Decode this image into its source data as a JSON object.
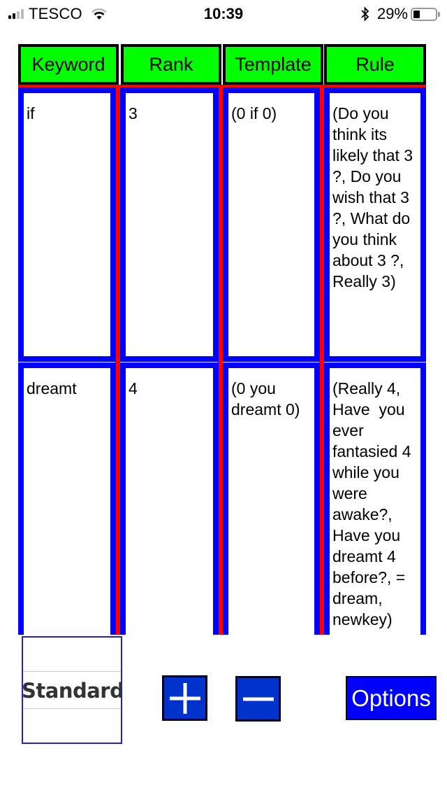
{
  "status_bar": {
    "carrier": "TESCO",
    "time": "10:39",
    "battery_percent_label": "29%",
    "battery_level": 0.29,
    "signal_bars_active": 2,
    "signal_bars_total": 4,
    "icons": [
      "signal-icon",
      "wifi-icon",
      "bluetooth-icon",
      "battery-icon"
    ]
  },
  "table": {
    "headers": [
      "Keyword",
      "Rank",
      "Template",
      "Rule"
    ],
    "rows": [
      {
        "keyword": "if",
        "rank": "3",
        "template": "(0 if 0)",
        "rule": "(Do you think its likely that 3 ?, Do you wish that 3 ?, What do you think about 3 ?, Really 3)"
      },
      {
        "keyword": "dreamt",
        "rank": "4",
        "template": "(0 you dreamt 0)",
        "rule": "(Really 4, Have  you ever fantasied 4 while you were awake?, Have you dreamt 4 before?, = dream, newkey)"
      }
    ],
    "colors": {
      "header_bg": "#00ff00",
      "header_border": "#000000",
      "cell_border": "#0000ff",
      "separator": "#ff0000"
    }
  },
  "controls": {
    "picker_selected": "Standard",
    "add_icon": "plus-icon",
    "remove_icon": "minus-icon",
    "options_label": "Options",
    "button_color": "#0033cc",
    "options_color": "#0000ff"
  }
}
